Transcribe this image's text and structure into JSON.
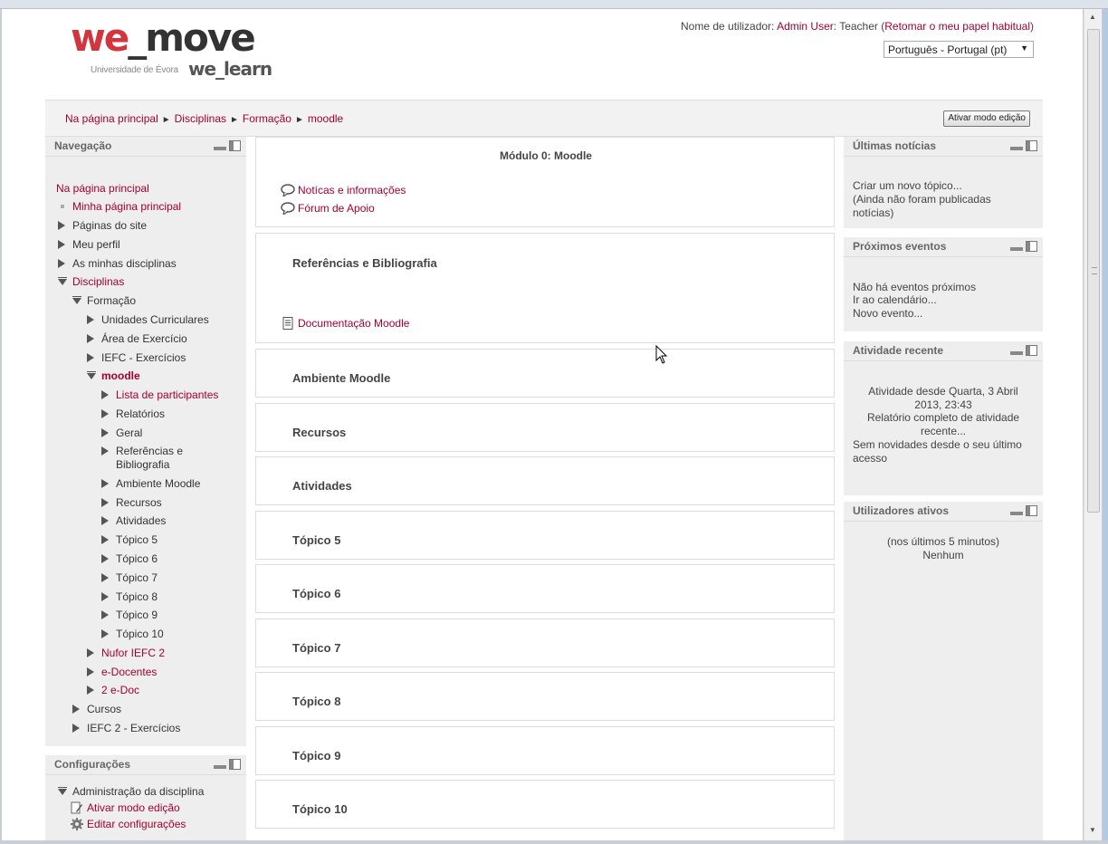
{
  "header": {
    "logo": {
      "we": "we",
      "move": "_move",
      "sub": "Universidade de Évora",
      "learn": "we_learn"
    },
    "login_prefix": "Nome de utilizador: ",
    "login_user": "Admin User",
    "login_role": ": Teacher (",
    "login_return": "Retomar o meu papel habitual",
    "login_close": ")",
    "language": "Português - Portugal (pt)"
  },
  "breadcrumb": {
    "items": [
      "Na página principal",
      "Disciplinas",
      "Formação",
      "moodle"
    ],
    "edit_button": "Ativar modo edição"
  },
  "navigation": {
    "title": "Navegação",
    "items": [
      {
        "label": "Na página principal"
      },
      {
        "label": "Minha página principal"
      },
      {
        "label": "Páginas do site"
      },
      {
        "label": "Meu perfil"
      },
      {
        "label": "As minhas disciplinas"
      },
      {
        "label": "Disciplinas"
      },
      {
        "label": "Formação"
      },
      {
        "label": "Unidades Curriculares"
      },
      {
        "label": "Área de Exercício"
      },
      {
        "label": "IEFC - Exercícios"
      },
      {
        "label": "moodle"
      },
      {
        "label": "Lista de participantes"
      },
      {
        "label": "Relatórios"
      },
      {
        "label": "Geral"
      },
      {
        "label": "Referências e"
      },
      {
        "label": "Bibliografia"
      },
      {
        "label": "Ambiente Moodle"
      },
      {
        "label": "Recursos"
      },
      {
        "label": "Atividades"
      },
      {
        "label": "Tópico 5"
      },
      {
        "label": "Tópico 6"
      },
      {
        "label": "Tópico 7"
      },
      {
        "label": "Tópico 8"
      },
      {
        "label": "Tópico 9"
      },
      {
        "label": "Tópico 10"
      },
      {
        "label": "Nufor IEFC 2"
      },
      {
        "label": "e-Docentes"
      },
      {
        "label": "2 e-Doc"
      },
      {
        "label": "Cursos"
      },
      {
        "label": "IEFC 2 - Exercícios"
      }
    ]
  },
  "settings": {
    "title": "Configurações",
    "items": [
      "Administração da disciplina",
      "Ativar modo edição",
      "Editar configurações"
    ]
  },
  "main": {
    "module_title": "Módulo 0: Moodle",
    "forum1": "Notícas e informações",
    "forum2": "Fórum de Apoio",
    "sections": [
      "Referências e Bibliografia",
      "Ambiente Moodle",
      "Recursos",
      "Atividades",
      "Tópico 5",
      "Tópico 6",
      "Tópico 7",
      "Tópico 8",
      "Tópico 9",
      "Tópico 10"
    ],
    "resource": "Documentação Moodle"
  },
  "right": {
    "news": {
      "title": "Últimas notícias",
      "link": "Criar um novo tópico...",
      "text1": "(Ainda não foram publicadas",
      "text2": "notícias)"
    },
    "events": {
      "title": "Próximos eventos",
      "text": "Não há eventos próximos",
      "link1": "Ir ao calendário...",
      "link2": "Novo evento..."
    },
    "activity": {
      "title": "Atividade recente",
      "since1": "Atividade desde Quarta, 3 Abril",
      "since2": "2013, 23:43",
      "report1": "Relatório completo de atividade",
      "report2": "recente...",
      "none1": "Sem novidades desde o seu último",
      "none2": "acesso"
    },
    "users": {
      "title": "Utilizadores ativos",
      "text1": "(nos últimos 5 minutos)",
      "text2": "Nenhum"
    }
  }
}
